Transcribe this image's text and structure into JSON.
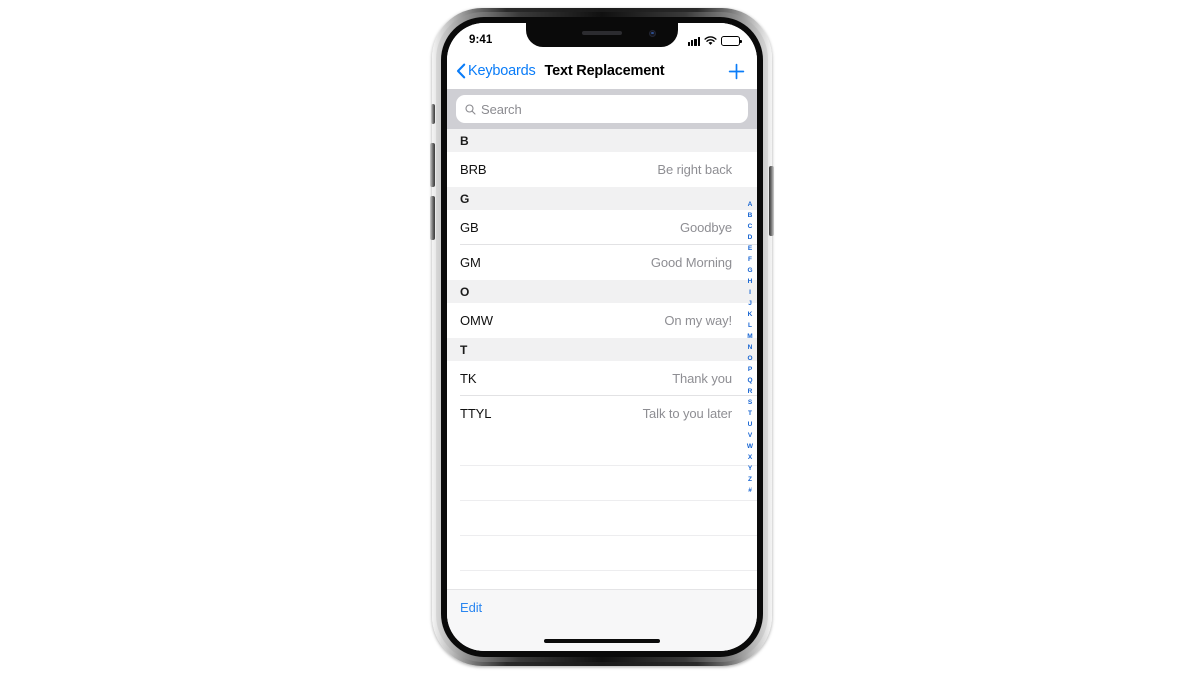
{
  "device": {
    "name": "iphone-x",
    "status_bar": {
      "time": "9:41",
      "cellular_icon": "cellular-signal-icon",
      "wifi_icon": "wifi-icon",
      "battery_icon": "battery-full-icon"
    },
    "home_indicator": "home-indicator"
  },
  "nav": {
    "back_label": "Keyboards",
    "back_icon": "chevron-left-icon",
    "title": "Text Replacement",
    "add_icon": "plus-icon",
    "accent_color": "#0a7cf8"
  },
  "search": {
    "placeholder": "Search",
    "value": "",
    "icon": "search-icon"
  },
  "list": {
    "sections": [
      {
        "letter": "B",
        "rows": [
          {
            "shortcut": "BRB",
            "phrase": "Be right back"
          }
        ]
      },
      {
        "letter": "G",
        "rows": [
          {
            "shortcut": "GB",
            "phrase": "Goodbye"
          },
          {
            "shortcut": "GM",
            "phrase": "Good Morning"
          }
        ]
      },
      {
        "letter": "O",
        "rows": [
          {
            "shortcut": "OMW",
            "phrase": "On my way!"
          }
        ]
      },
      {
        "letter": "T",
        "rows": [
          {
            "shortcut": "TK",
            "phrase": "Thank you"
          },
          {
            "shortcut": "TTYL",
            "phrase": "Talk to you later"
          }
        ]
      }
    ],
    "empty_row_count": 4
  },
  "section_index": {
    "letters": [
      "A",
      "B",
      "C",
      "D",
      "E",
      "F",
      "G",
      "H",
      "I",
      "J",
      "K",
      "L",
      "M",
      "N",
      "O",
      "P",
      "Q",
      "R",
      "S",
      "T",
      "U",
      "V",
      "W",
      "X",
      "Y",
      "Z",
      "#"
    ],
    "color": "#1463d2"
  },
  "toolbar": {
    "edit_label": "Edit"
  },
  "colors": {
    "tint": "#0a7cf8",
    "search_bar_background": "#cfcfd4",
    "section_header_background": "#f1f1f2",
    "secondary_text": "#8e8e93",
    "toolbar_background": "#f7f7f8",
    "page_background": "#ffffff"
  }
}
